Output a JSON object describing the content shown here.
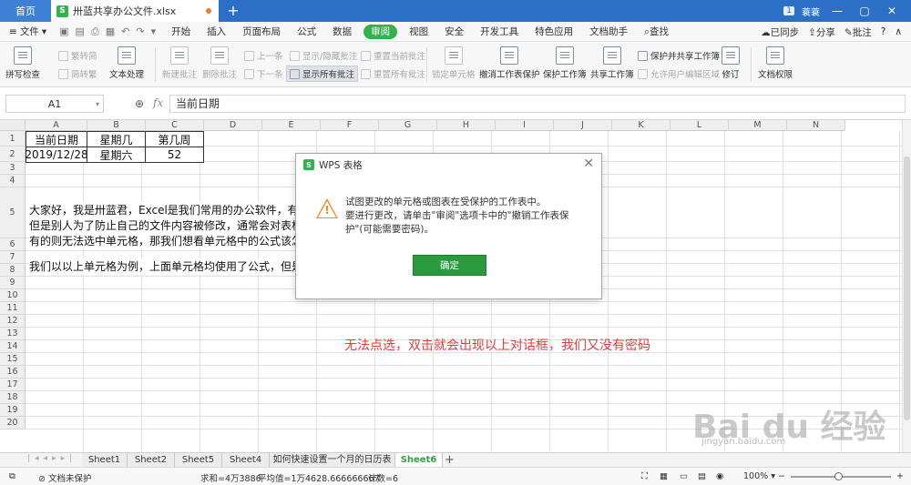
{
  "title_bar": {
    "home_tab": "首页",
    "doc_tab": "卅蓝共享办公文件.xlsx",
    "doc_icon": "S",
    "page_badge": "1",
    "user": "蓑蓑"
  },
  "menu": {
    "file": "文件",
    "items": [
      "开始",
      "插入",
      "页面布局",
      "公式",
      "数据",
      "审阅",
      "视图",
      "安全",
      "开发工具",
      "特色应用",
      "文档助手",
      "查找"
    ],
    "active_index": 5,
    "right": {
      "sync": "已同步",
      "share": "分享",
      "comment": "批注"
    }
  },
  "ribbon": {
    "spellcheck": "拼写检查",
    "trad_to_simp": "繁转简",
    "simp_to_trad": "简转繁",
    "text_process": "文本处理",
    "new_comment": "新建批注",
    "delete_comment": "删除批注",
    "prev": "上一条",
    "next": "下一条",
    "show_hide_comment": "显示/隐藏批注",
    "show_all_comments": "显示所有批注",
    "reset_current_comment": "重置当前批注",
    "reset_all_comments": "重置所有批注",
    "lock_cells": "锁定单元格",
    "unprotect_sheet": "撤消工作表保护",
    "protect_workbook": "保护工作簿",
    "share_workbook": "共享工作簿",
    "protect_share_workbook": "保护并共享工作簿",
    "allow_edit_ranges": "允许用户编辑区域",
    "track_changes": "修订",
    "doc_rights": "文档权限"
  },
  "formula_bar": {
    "name_box": "A1",
    "fx": "fx",
    "content": "当前日期"
  },
  "grid": {
    "columns": [
      "A",
      "B",
      "C",
      "D",
      "E",
      "F",
      "G",
      "H",
      "I",
      "J",
      "K",
      "L",
      "M",
      "N"
    ],
    "rows": [
      "1",
      "2",
      "3",
      "4",
      "5",
      "6",
      "7",
      "8",
      "9",
      "10",
      "11",
      "12",
      "13",
      "14",
      "15",
      "16",
      "17",
      "18",
      "19",
      "20"
    ],
    "headers": [
      "当前日期",
      "星期几",
      "第几周"
    ],
    "values": [
      "2019/12/28",
      "星期六",
      "52"
    ],
    "row5_lines": [
      "大家好，我是卅蓝君，Excel是我们常用的办公软件，有的",
      "但是别人为了防止自己的文件内容被修改，通常会对表格",
      "有的则无法选中单元格，那我们想看单元格中的公式该怎"
    ],
    "row6_text": "我们以以上单元格为例，上面单元格均使用了公式，但是"
  },
  "dialog": {
    "title": "WPS 表格",
    "message_lines": [
      "试图更改的单元格或图表在受保护的工作表中。",
      "要进行更改，请单击\"审阅\"选项卡中的\"撤销工作表保",
      "护\"(可能需要密码)。"
    ],
    "ok_button": "确定"
  },
  "annotation": "无法点选，双击就会出现以上对话框，我们又没有密码",
  "sheets": {
    "tabs": [
      "Sheet1",
      "Sheet2",
      "Sheet5",
      "Sheet4",
      "如何快速设置一个月的日历表",
      "Sheet6"
    ],
    "active_index": 5
  },
  "status_bar": {
    "doc_status": "文档未保护",
    "sum": "求和=4万3886",
    "average": "平均值=1万4628.666666667",
    "count": "计数=6",
    "zoom": "100%"
  },
  "watermark": {
    "main": "Bai du 经验",
    "sub": "jingyan.baidu.com"
  },
  "colors": {
    "title_bar": "#2c6fc7",
    "accent_green": "#2fb34a",
    "annotation_red": "#e53a3a",
    "warning_orange": "#f08a2a"
  }
}
